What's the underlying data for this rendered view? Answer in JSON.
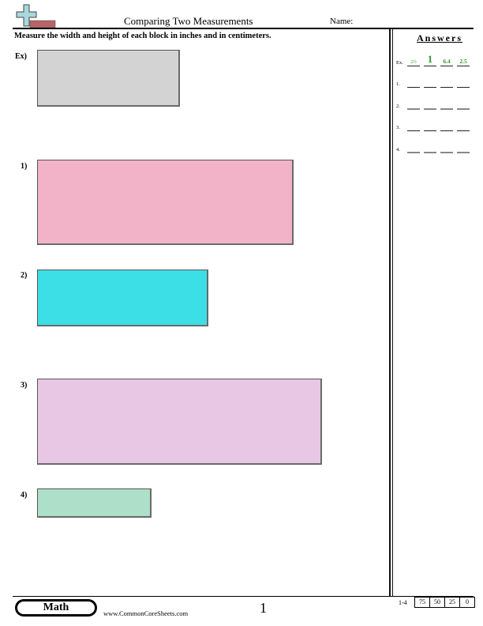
{
  "header": {
    "logo_icon": "plus-ruler-logo-icon",
    "title": "Comparing Two Measurements",
    "name_label": "Name:"
  },
  "instructions": "Measure the width and height of each block in inches and in centimeters.",
  "problems": [
    {
      "label": "Ex)",
      "color": "#d3d3d3"
    },
    {
      "label": "1)",
      "color": "#f2b3c8"
    },
    {
      "label": "2)",
      "color": "#3ddfe6"
    },
    {
      "label": "3)",
      "color": "#e8c7e4"
    },
    {
      "label": "4)",
      "color": "#aedfc8"
    }
  ],
  "answers": {
    "title": "Answers",
    "rows": [
      {
        "label": "Ex.",
        "values": [
          "2½",
          "1",
          "6.4",
          "2.5"
        ]
      },
      {
        "label": "1.",
        "values": [
          "",
          "",
          "",
          ""
        ]
      },
      {
        "label": "2.",
        "values": [
          "",
          "",
          "",
          ""
        ]
      },
      {
        "label": "3.",
        "values": [
          "",
          "",
          "",
          ""
        ]
      },
      {
        "label": "4.",
        "values": [
          "",
          "",
          "",
          ""
        ]
      }
    ],
    "answer_color": "#2a9a2a"
  },
  "footer": {
    "subject": "Math",
    "website": "www.CommonCoreSheets.com",
    "page_number": "1",
    "score_label": "1-4",
    "scores": [
      "75",
      "50",
      "25",
      "0"
    ]
  }
}
